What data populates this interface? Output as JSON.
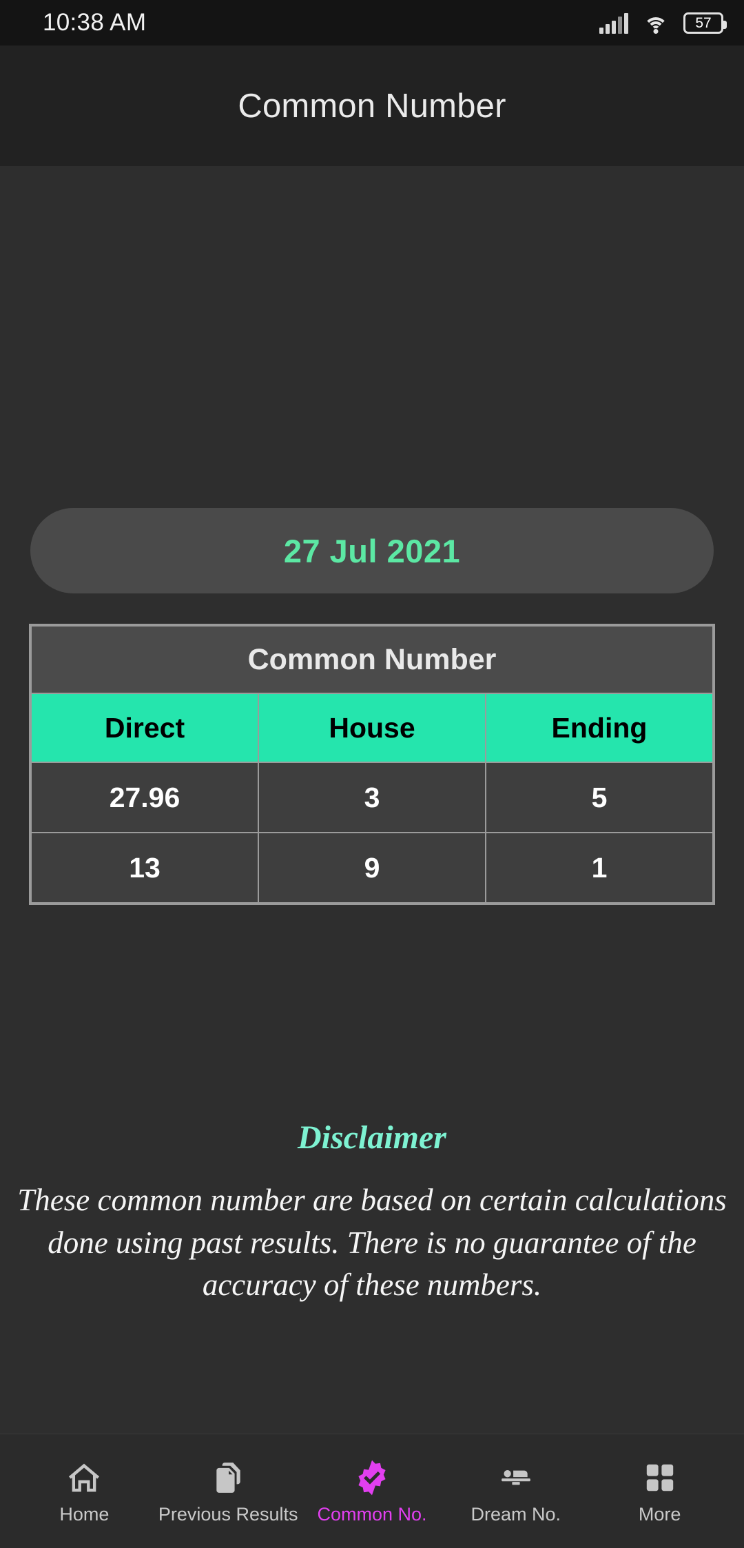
{
  "status_bar": {
    "time": "10:38 AM",
    "battery_percent": "57",
    "signal_icon": "cellular-signal-icon",
    "wifi_icon": "wifi-icon",
    "battery_icon": "battery-icon"
  },
  "app_bar": {
    "title": "Common Number"
  },
  "date_selector": {
    "value": "27 Jul 2021"
  },
  "table": {
    "title": "Common Number",
    "columns": [
      "Direct",
      "House",
      "Ending"
    ],
    "rows": [
      [
        "27.96",
        "3",
        "5"
      ],
      [
        "13",
        "9",
        "1"
      ]
    ]
  },
  "disclaimer": {
    "title": "Disclaimer",
    "body": "These common number are based on certain calculations done using past results. There is no guarantee of the accuracy of these numbers."
  },
  "bottom_nav": {
    "items": [
      {
        "label": "Home",
        "icon": "home-icon",
        "active": false
      },
      {
        "label": "Previous Results",
        "icon": "documents-icon",
        "active": false
      },
      {
        "label": "Common No.",
        "icon": "verified-badge-icon",
        "active": true
      },
      {
        "label": "Dream No.",
        "icon": "bed-icon",
        "active": false
      },
      {
        "label": "More",
        "icon": "grid-icon",
        "active": false
      }
    ]
  },
  "colors": {
    "page_background": "#2e2e2e",
    "appbar_background": "#222222",
    "statusbar_background": "#141414",
    "accent_green": "#25e5ad",
    "date_green": "#5ce8a4",
    "disclaimer_green": "#7ef2d2",
    "active_nav_magenta": "#e23ff0",
    "cell_background": "#3e3e3e",
    "table_border": "#9b9b9b"
  }
}
